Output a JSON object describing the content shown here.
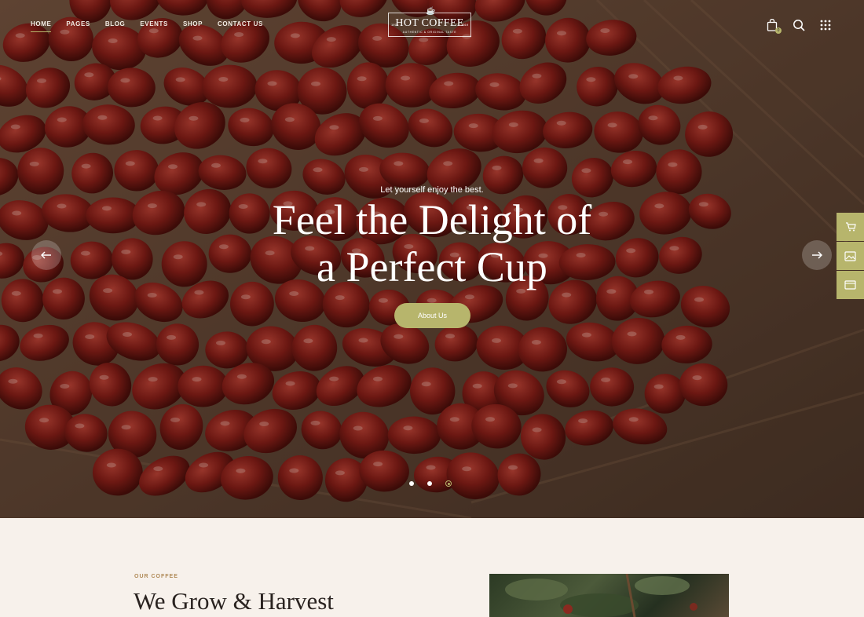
{
  "nav": {
    "items": [
      {
        "label": "HOME",
        "active": true
      },
      {
        "label": "PAGES"
      },
      {
        "label": "BLOG"
      },
      {
        "label": "EVENTS"
      },
      {
        "label": "SHOP"
      },
      {
        "label": "CONTACT US"
      }
    ]
  },
  "logo": {
    "name": "HOT COFFEE",
    "tagline": "AUTHENTIC & ORIGINAL TASTE",
    "left_year": "1970",
    "right_year": "2019"
  },
  "header_icons": {
    "cart_count": "0",
    "icons": [
      "shopping-bag-icon",
      "search-icon",
      "grid-menu-icon"
    ]
  },
  "hero": {
    "subtitle": "Let yourself enjoy the best.",
    "title_line1": "Feel the Delight of",
    "title_line2": "a Perfect Cup",
    "cta_label": "About Us",
    "slides_total": 3,
    "active_slide": 3
  },
  "side_tools": [
    "cart-icon",
    "gallery-icon",
    "browser-window-icon"
  ],
  "about": {
    "eyebrow": "OUR COFFEE",
    "title": "We Grow & Harvest"
  },
  "colors": {
    "accent": "#b7b56c",
    "eyebrow": "#b08a57",
    "section_bg": "#f7f1eb"
  }
}
